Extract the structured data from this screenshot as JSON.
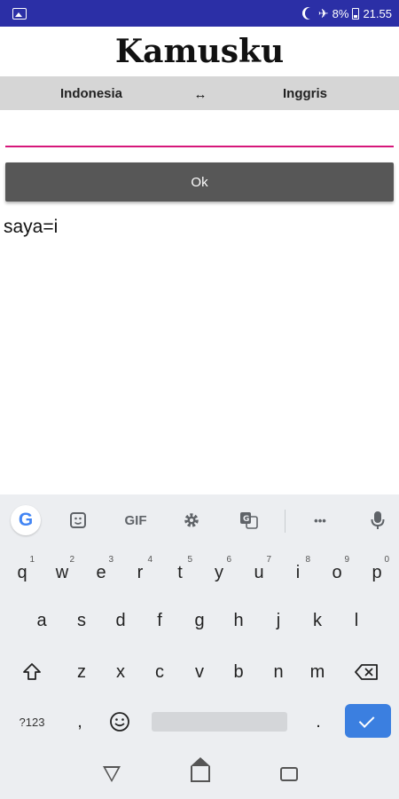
{
  "status_bar": {
    "battery": "8%",
    "time": "21.55"
  },
  "app": {
    "title": "Kamusku",
    "from_lang": "Indonesia",
    "swap_symbol": "↔",
    "to_lang": "Inggris",
    "input_value": "",
    "ok_label": "Ok",
    "result": "saya=i"
  },
  "keyboard": {
    "toolbar": {
      "google": "G",
      "gif": "GIF",
      "more": "•••"
    },
    "row1": [
      {
        "k": "q",
        "h": "1"
      },
      {
        "k": "w",
        "h": "2"
      },
      {
        "k": "e",
        "h": "3"
      },
      {
        "k": "r",
        "h": "4"
      },
      {
        "k": "t",
        "h": "5"
      },
      {
        "k": "y",
        "h": "6"
      },
      {
        "k": "u",
        "h": "7"
      },
      {
        "k": "i",
        "h": "8"
      },
      {
        "k": "o",
        "h": "9"
      },
      {
        "k": "p",
        "h": "0"
      }
    ],
    "row2": [
      "a",
      "s",
      "d",
      "f",
      "g",
      "h",
      "j",
      "k",
      "l"
    ],
    "row3": [
      "z",
      "x",
      "c",
      "v",
      "b",
      "n",
      "m"
    ],
    "bottom": {
      "symbols": "?123",
      "comma": ",",
      "period": "."
    }
  }
}
